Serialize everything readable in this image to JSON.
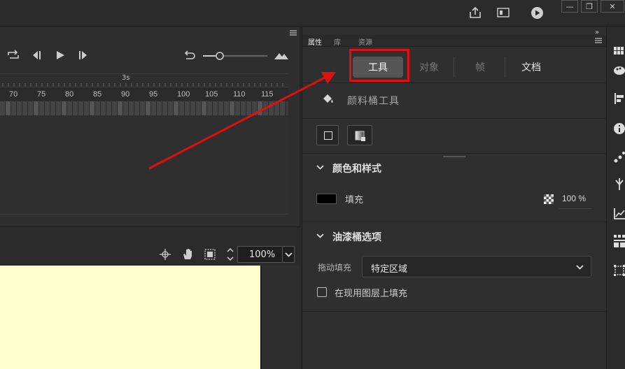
{
  "topbar": {
    "minimize_label": "—",
    "restore_label": "❐",
    "close_label": "✕"
  },
  "timeline": {
    "time_marker": "3s",
    "ruler": [
      "70",
      "75",
      "80",
      "85",
      "90",
      "95",
      "100",
      "105",
      "110",
      "115"
    ]
  },
  "stage": {
    "zoom_value": "100%"
  },
  "panel": {
    "tabs": [
      "属性",
      "库",
      "资源"
    ],
    "segments": [
      "工具",
      "对象",
      "帧",
      "文档"
    ],
    "tool_name": "颜料桶工具",
    "color_section_title": "颜色和样式",
    "fill_label": "填充",
    "fill_opacity": "100 %",
    "fill_color": "#000000",
    "bucket_section_title": "油漆桶选项",
    "drag_fill_label": "拖动填充",
    "drag_fill_value": "特定区域",
    "fill_on_layers_label": "在现用图层上填充"
  },
  "colors": {
    "highlight_box": "#e01010",
    "arrow": "#e01010",
    "stage": "#ffffcf"
  }
}
